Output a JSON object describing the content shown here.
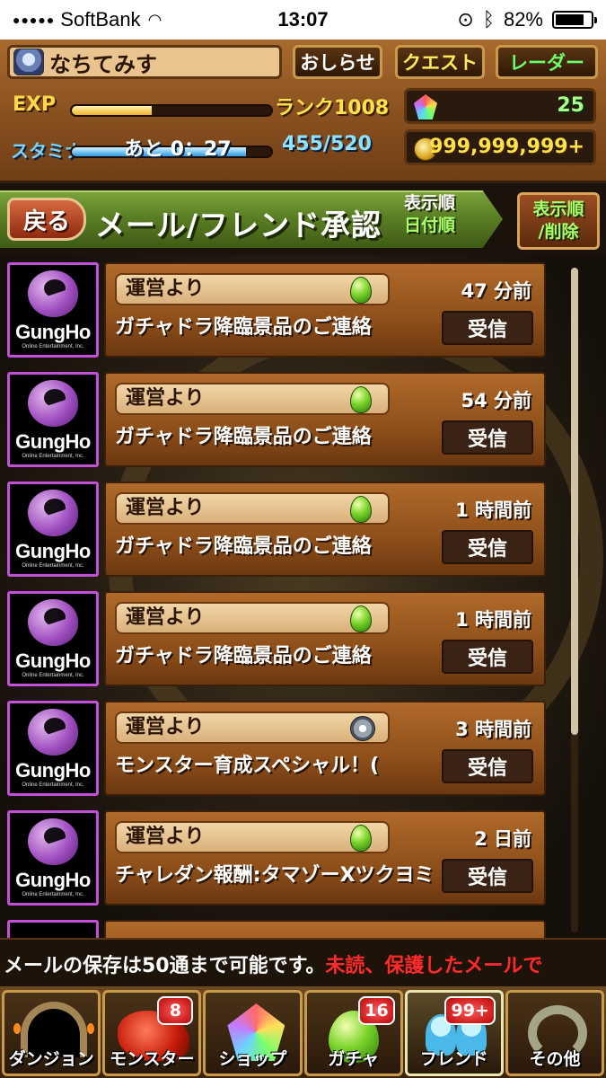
{
  "status_bar": {
    "carrier": "SoftBank",
    "time": "13:07",
    "battery": "82%",
    "battery_fraction": 0.82
  },
  "header": {
    "player_name": "なちてみす",
    "buttons": {
      "news": "おしらせ",
      "quest": "クエスト",
      "radar": "レーダー"
    },
    "exp_label": "EXP",
    "exp_fraction": 0.4,
    "rank": "ランク1008",
    "stamina_label": "スタミナ",
    "stamina_timer": "あと 0：27",
    "stamina_value": "455/520",
    "stamina_fraction": 0.875,
    "magic_stones": "25",
    "coins": "999,999,999+"
  },
  "title_bar": {
    "back": "戻る",
    "title": "メール/フレンド承認",
    "sort_line1": "表示順",
    "sort_line2": "日付順",
    "sort_button_line1": "表示順",
    "sort_button_line2": "/削除"
  },
  "logo": {
    "name": "GungHo",
    "sub": "Online Entertainment, Inc."
  },
  "mails": [
    {
      "sender": "運営より",
      "time": "47 分前",
      "subject": "ガチャドラ降臨景品のご連絡",
      "button": "受信",
      "icon": "green-egg-icon"
    },
    {
      "sender": "運営より",
      "time": "54 分前",
      "subject": "ガチャドラ降臨景品のご連絡",
      "button": "受信",
      "icon": "green-egg-icon"
    },
    {
      "sender": "運営より",
      "time": "1 時間前",
      "subject": "ガチャドラ降臨景品のご連絡",
      "button": "受信",
      "icon": "green-egg-icon"
    },
    {
      "sender": "運営より",
      "time": "1 時間前",
      "subject": "ガチャドラ降臨景品のご連絡",
      "button": "受信",
      "icon": "green-egg-icon"
    },
    {
      "sender": "運営より",
      "time": "3 時間前",
      "subject": "モンスター育成スペシャル！(",
      "button": "受信",
      "icon": "silver-medal-icon"
    },
    {
      "sender": "運営より",
      "time": "2 日前",
      "subject": "チャレダン報酬:タマゾーXツクヨミ",
      "button": "受信",
      "icon": "green-egg-icon"
    }
  ],
  "ticker": {
    "white": "メールの保存は50通まで可能です。",
    "red": "未読、保護したメールで"
  },
  "nav": [
    {
      "label": "ダンジョン",
      "badge": ""
    },
    {
      "label": "モンスター",
      "badge": "8"
    },
    {
      "label": "ショップ",
      "badge": ""
    },
    {
      "label": "ガチャ",
      "badge": "16"
    },
    {
      "label": "フレンド",
      "badge": "99+"
    },
    {
      "label": "その他",
      "badge": ""
    }
  ]
}
